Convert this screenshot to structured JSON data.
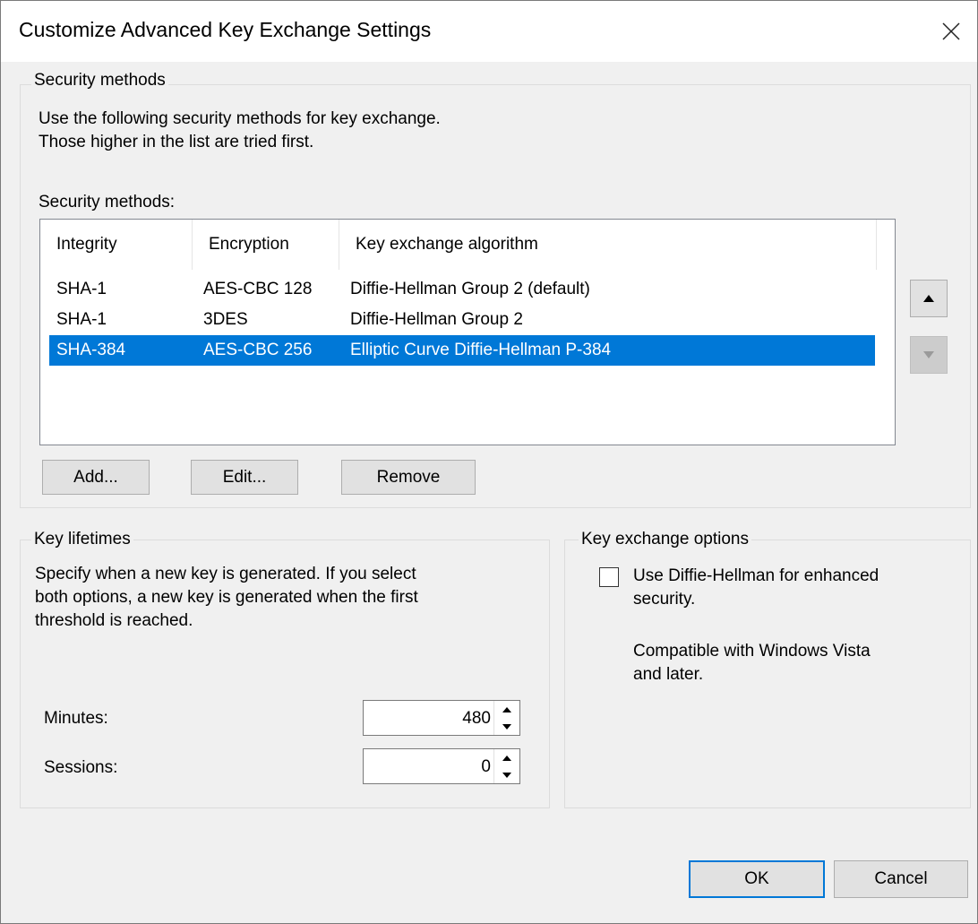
{
  "window": {
    "title": "Customize Advanced Key Exchange Settings"
  },
  "security_methods_group": {
    "label": "Security methods",
    "description_line1": "Use the following security methods for key exchange.",
    "description_line2": "Those higher in the list are tried first.",
    "list_label": "Security methods:",
    "columns": [
      "Integrity",
      "Encryption",
      "Key exchange algorithm"
    ],
    "rows": [
      {
        "integrity": "SHA-1",
        "encryption": "AES-CBC 128",
        "algorithm": "Diffie-Hellman Group 2 (default)",
        "selected": false
      },
      {
        "integrity": "SHA-1",
        "encryption": "3DES",
        "algorithm": "Diffie-Hellman Group 2",
        "selected": false
      },
      {
        "integrity": "SHA-384",
        "encryption": "AES-CBC 256",
        "algorithm": "Elliptic Curve Diffie-Hellman P-384",
        "selected": true
      }
    ],
    "buttons": {
      "add": "Add...",
      "edit": "Edit...",
      "remove": "Remove"
    }
  },
  "key_lifetimes_group": {
    "label": "Key lifetimes",
    "description_line1": "Specify when a new key is generated. If you select",
    "description_line2": "both options, a new key is generated when the first",
    "description_line3": "threshold is reached.",
    "minutes_label": "Minutes:",
    "minutes_value": "480",
    "sessions_label": "Sessions:",
    "sessions_value": "0"
  },
  "key_exchange_options_group": {
    "label": "Key exchange options",
    "checkbox_label_line1": "Use Diffie-Hellman for enhanced",
    "checkbox_label_line2": "security.",
    "checked": false,
    "note_line1": "Compatible with Windows Vista",
    "note_line2": "and later."
  },
  "footer": {
    "ok": "OK",
    "cancel": "Cancel"
  },
  "colors": {
    "selection": "#0078d7",
    "background": "#f0f0f0"
  }
}
